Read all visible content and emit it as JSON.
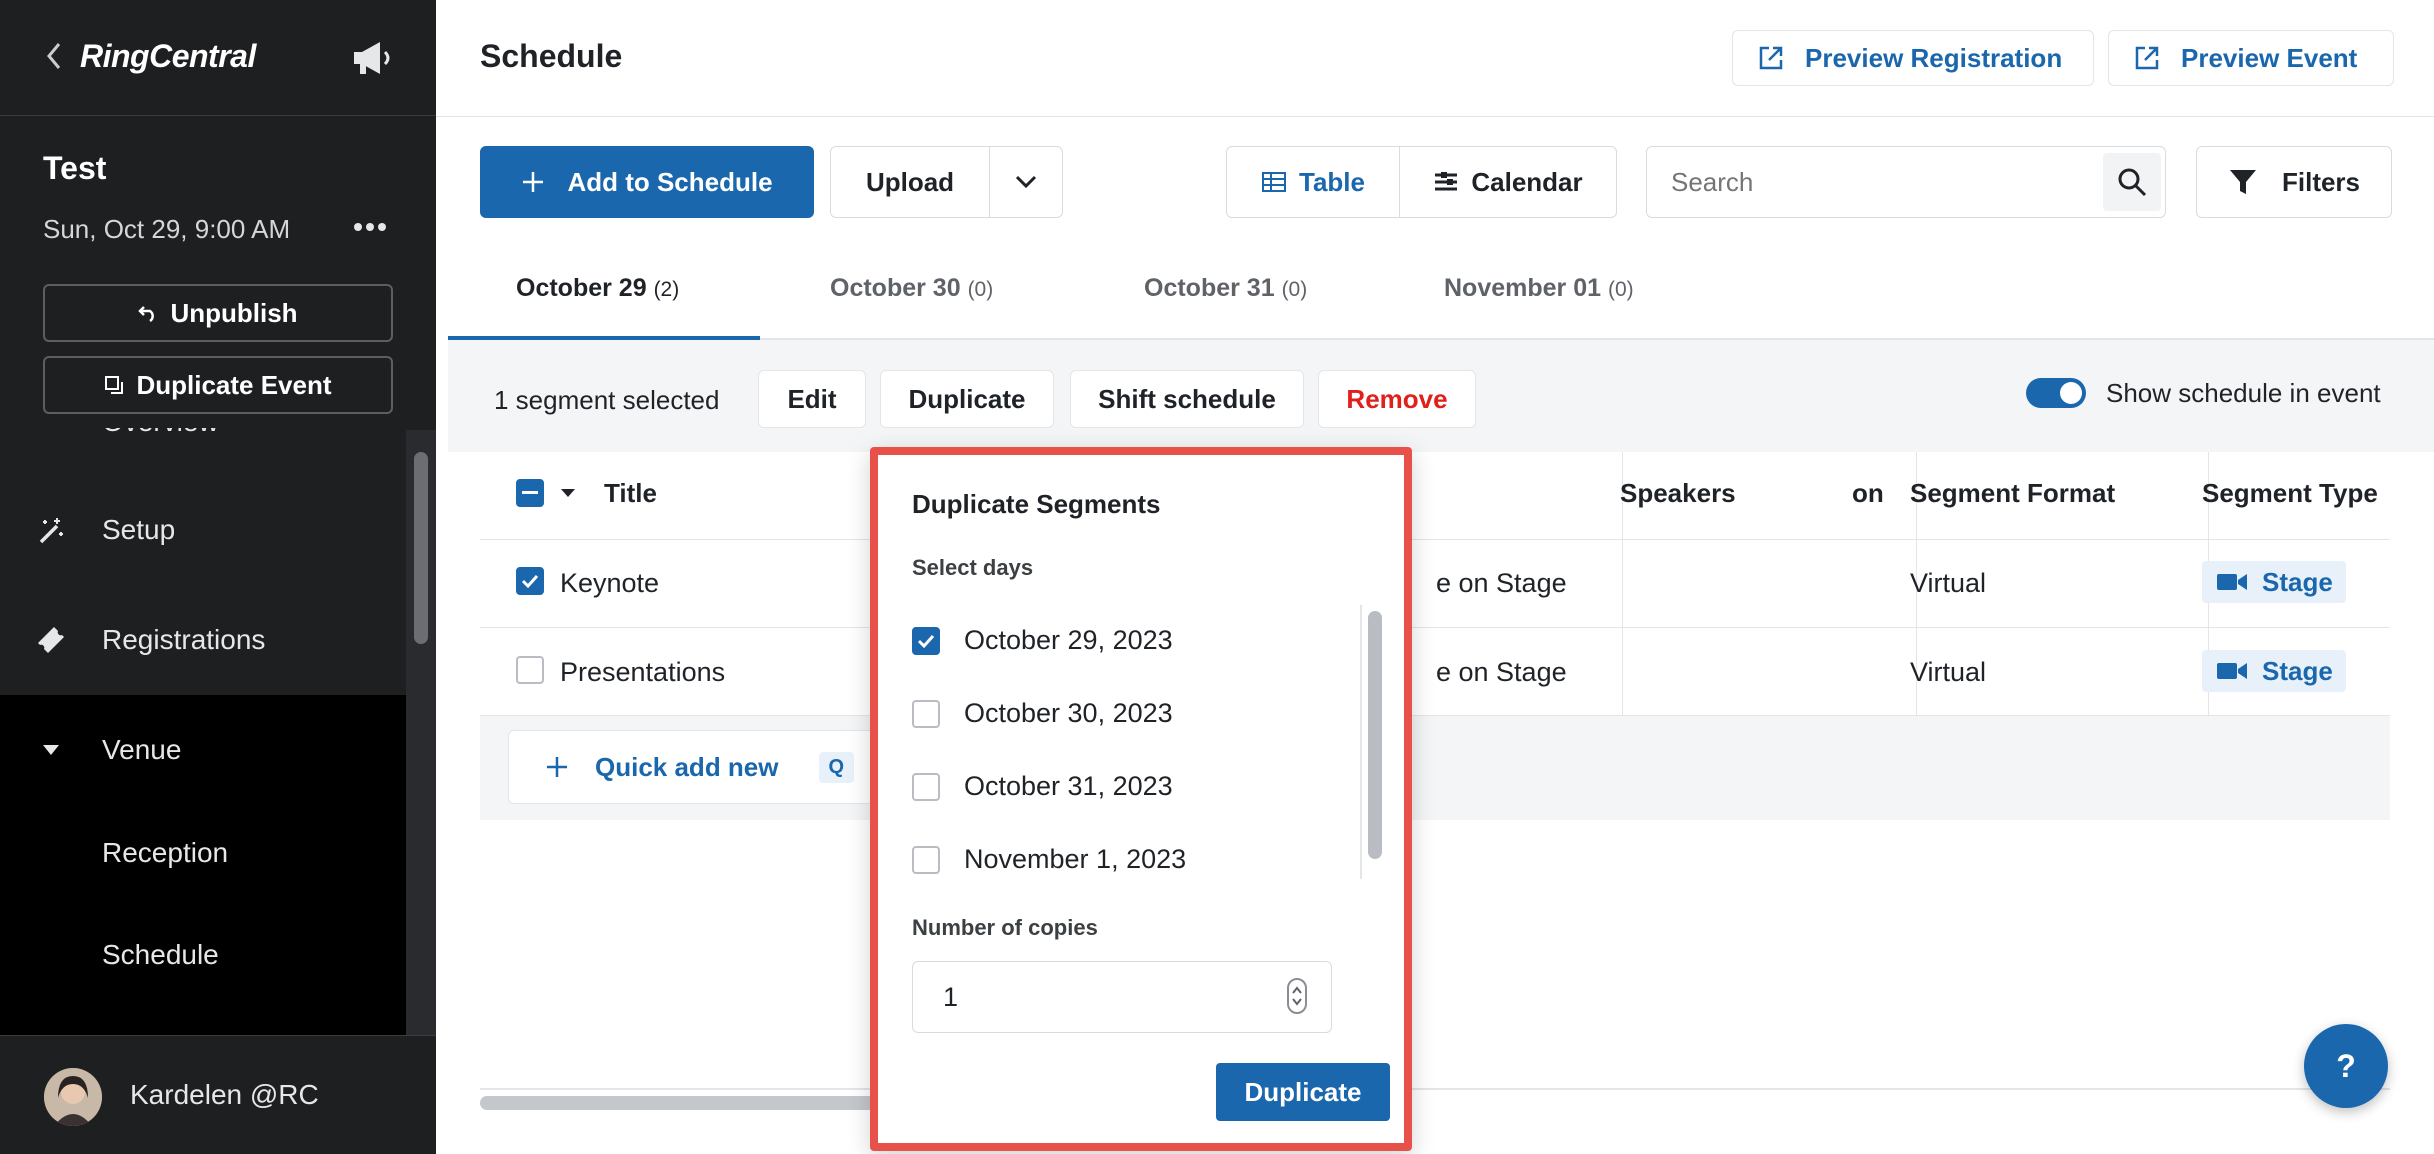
{
  "sidebar": {
    "logo": "RingCentral",
    "event_title": "Test",
    "event_date": "Sun, Oct 29, 9:00 AM",
    "unpublish_label": "Unpublish",
    "duplicate_event_label": "Duplicate Event",
    "overview_label": "Overview",
    "nav": [
      {
        "label": "Setup",
        "icon": "magic-wand-icon"
      },
      {
        "label": "Registrations",
        "icon": "ticket-icon"
      },
      {
        "label": "Venue",
        "icon": "caret-down-icon"
      }
    ],
    "venue_children": [
      "Reception",
      "Schedule"
    ],
    "user_name": "Kardelen @RC"
  },
  "header": {
    "title": "Schedule",
    "preview_registration": "Preview Registration",
    "preview_event": "Preview Event"
  },
  "toolbar": {
    "add_to_schedule": "Add to Schedule",
    "upload": "Upload",
    "view_table": "Table",
    "view_calendar": "Calendar",
    "search_placeholder": "Search",
    "filters": "Filters"
  },
  "date_tabs": [
    {
      "label": "October 29",
      "count": "(2)",
      "active": true
    },
    {
      "label": "October 30",
      "count": "(0)",
      "active": false
    },
    {
      "label": "October 31",
      "count": "(0)",
      "active": false
    },
    {
      "label": "November 01",
      "count": "(0)",
      "active": false
    }
  ],
  "selection_bar": {
    "status": "1 segment selected",
    "edit": "Edit",
    "duplicate": "Duplicate",
    "shift_schedule": "Shift schedule",
    "remove": "Remove",
    "show_schedule_label": "Show schedule in event",
    "show_schedule_on": true
  },
  "table": {
    "columns": [
      "Title",
      "on",
      "Speakers",
      "Segment Format",
      "Segment Type"
    ],
    "rows": [
      {
        "title": "Keynote",
        "location": "e on Stage",
        "format": "Virtual",
        "type": "Stage",
        "checked": true
      },
      {
        "title": "Presentations",
        "location": "e on Stage",
        "format": "Virtual",
        "type": "Stage",
        "checked": false
      }
    ],
    "quick_add": "Quick add new",
    "quick_add_shortcut": "Q"
  },
  "popover": {
    "title": "Duplicate Segments",
    "select_days_label": "Select days",
    "days": [
      {
        "label": "October 29, 2023",
        "checked": true
      },
      {
        "label": "October 30, 2023",
        "checked": false
      },
      {
        "label": "October 31, 2023",
        "checked": false
      },
      {
        "label": "November 1, 2023",
        "checked": false
      }
    ],
    "copies_label": "Number of copies",
    "copies_value": "1",
    "submit": "Duplicate"
  },
  "help_button": "?",
  "colors": {
    "brand_blue": "#1a67ad",
    "danger_red": "#e0201b",
    "highlight": "#e8514a",
    "sidebar_bg": "#1e1f21"
  }
}
